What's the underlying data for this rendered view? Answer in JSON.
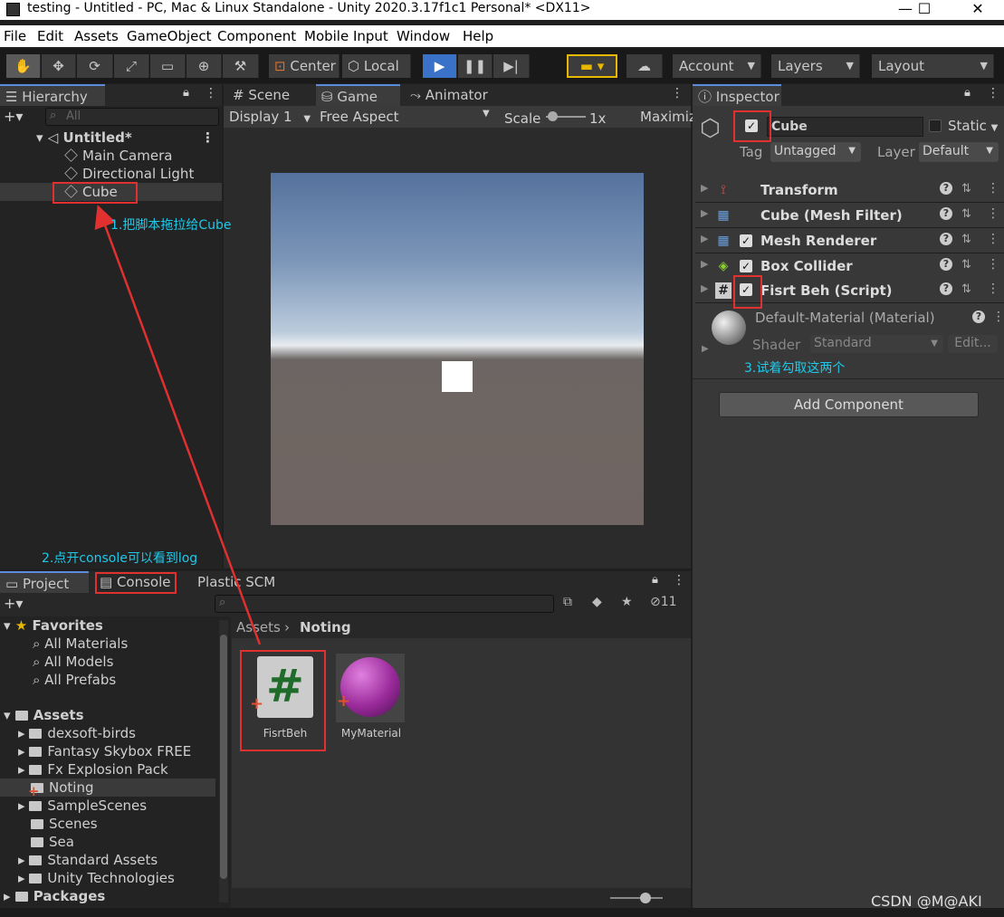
{
  "window": {
    "title": "testing - Untitled - PC, Mac & Linux Standalone - Unity 2020.3.17f1c1 Personal* <DX11>",
    "minimize": "—",
    "maximize": "☐",
    "close": "✕"
  },
  "menu": [
    "File",
    "Edit",
    "Assets",
    "GameObject",
    "Component",
    "Mobile Input",
    "Window",
    "Help"
  ],
  "toolbar": {
    "center": "Center",
    "local": "Local",
    "account": "Account",
    "layers": "Layers",
    "layout": "Layout"
  },
  "hierarchy": {
    "tab": "Hierarchy",
    "search_placeholder": "All",
    "scene": "Untitled*",
    "items": [
      "Main Camera",
      "Directional Light",
      "Cube"
    ]
  },
  "game": {
    "tabs": [
      "Scene",
      "Game",
      "Animator"
    ],
    "display": "Display 1",
    "aspect": "Free Aspect",
    "scale_label": "Scale",
    "scale_value": "1x",
    "maximize": "Maximiz"
  },
  "inspector": {
    "tab": "Inspector",
    "object_name": "Cube",
    "static_label": "Static",
    "tag_label": "Tag",
    "tag_value": "Untagged",
    "layer_label": "Layer",
    "layer_value": "Default",
    "components": [
      "Transform",
      "Cube (Mesh Filter)",
      "Mesh Renderer",
      "Box Collider",
      "Fisrt Beh (Script)"
    ],
    "material": "Default-Material (Material)",
    "shader_label": "Shader",
    "shader_value": "Standard",
    "edit": "Edit...",
    "add_component": "Add Component"
  },
  "bottom": {
    "tabs": [
      "Project",
      "Console",
      "Plastic SCM"
    ],
    "hidden_count": "11",
    "breadcrumb_root": "Assets",
    "breadcrumb_current": "Noting",
    "favorites_label": "Favorites",
    "favorites": [
      "All Materials",
      "All Models",
      "All Prefabs"
    ],
    "assets_label": "Assets",
    "folders": [
      "dexsoft-birds",
      "Fantasy Skybox FREE",
      "Fx Explosion Pack",
      "Noting",
      "SampleScenes",
      "Scenes",
      "Sea",
      "Standard Assets",
      "Unity Technologies"
    ],
    "packages_label": "Packages",
    "files": [
      "FisrtBeh",
      "MyMaterial"
    ]
  },
  "annotations": {
    "step1": "1.把脚本拖拉给Cube",
    "step2": "2.点开console可以看到log",
    "step3": "3.试着勾取这两个"
  },
  "watermark": "CSDN @M@AKI",
  "colors": {
    "accent_red": "#e03030",
    "annotation_cyan": "#20c8e8",
    "play_blue": "#3a72c8"
  }
}
